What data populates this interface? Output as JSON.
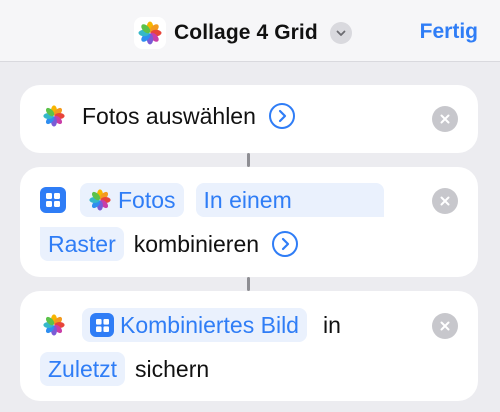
{
  "header": {
    "title": "Collage 4 Grid",
    "done_label": "Fertig",
    "app_icon": "photos-icon",
    "menu_icon": "chevron-down-icon"
  },
  "actions": [
    {
      "icon": "photos-icon",
      "label": "Fotos auswählen",
      "expand_icon": "chevron-right-circle-icon"
    },
    {
      "icon": "grid-icon",
      "input_chip": "Fotos",
      "mode_chip_line1": "In einem",
      "mode_chip_line2": "Raster",
      "verb": "kombinieren",
      "expand_icon": "chevron-right-circle-icon"
    },
    {
      "icon": "photos-icon",
      "input_chip": "Kombiniertes Bild",
      "preposition": "in",
      "album_chip": "Zuletzt",
      "verb": "sichern"
    }
  ],
  "colors": {
    "accent": "#2f7df6",
    "background": "#ececf0",
    "card": "#ffffff",
    "chip_background": "#eaf1fd",
    "remove_button": "#c7c7cc"
  }
}
